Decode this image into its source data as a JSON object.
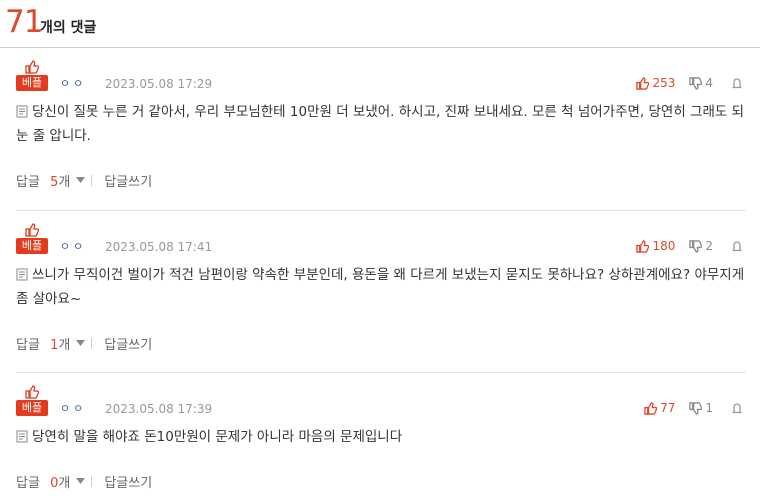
{
  "header": {
    "count": "71",
    "label": "개의 댓글"
  },
  "colors": {
    "accent": "#e0452d",
    "author": "#3b5fa0",
    "muted": "#999999"
  },
  "labels": {
    "best_tag": "베플",
    "reply": "답글",
    "reply_unit": "개",
    "write_reply": "답글쓰기"
  },
  "comments": [
    {
      "author": "ㅇㅇ",
      "date": "2023.05.08 17:29",
      "likes": "253",
      "dislikes": "4",
      "text": "당신이 질못 누른 거 같아서, 우리 부모님한테 10만원 더 보냈어. 하시고, 진짜 보내세요. 모른 척 넘어가주면, 당연히 그래도 되눈 줄 압니다.",
      "reply_count": "5"
    },
    {
      "author": "ㅇㅇ",
      "date": "2023.05.08 17:41",
      "likes": "180",
      "dislikes": "2",
      "text": "쓰니가 무직이건 벌이가 적건 남편이랑 약속한 부분인데, 용돈을 왜 다르게 보냈는지 묻지도 못하나요? 상하관계에요? 야무지게 좀 살아요~",
      "reply_count": "1"
    },
    {
      "author": "ㅇㅇ",
      "date": "2023.05.08 17:39",
      "likes": "77",
      "dislikes": "1",
      "text": "당연히 말을 해야죠 돈10만원이 문제가 아니라 마음의 문제입니다",
      "reply_count": "0"
    }
  ]
}
